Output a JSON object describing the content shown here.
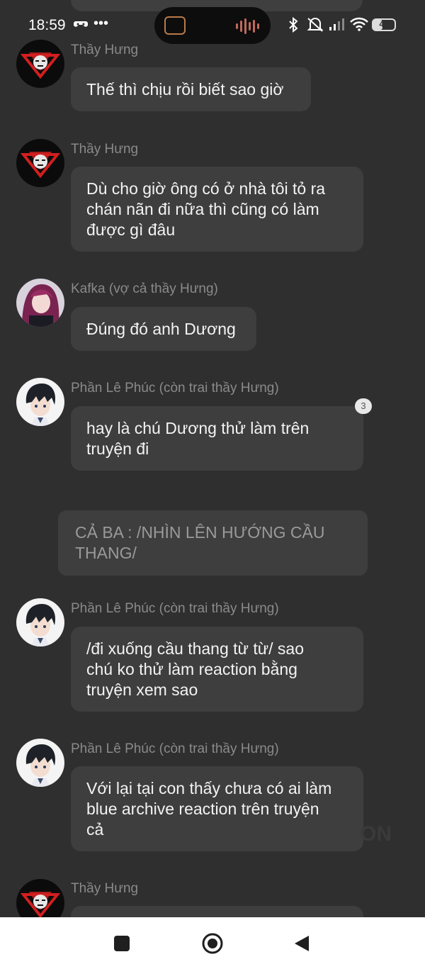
{
  "status_bar": {
    "time": "18:59",
    "battery_level": "43",
    "battery_fraction": 0.43,
    "icons": [
      "game-controller-icon",
      "more-dots-icon",
      "bluetooth-icon",
      "mute-icon",
      "signal-icon",
      "wifi-icon",
      "battery-icon"
    ]
  },
  "messages": [
    {
      "sender": "Thầy Hưng",
      "avatar": "demon-mask-avatar",
      "text": "Thế thì chịu rồi biết sao giờ"
    },
    {
      "sender": "Thầy Hưng",
      "avatar": "demon-mask-avatar",
      "text": "Dù cho giờ ông có ở nhà tôi tỏ ra\nchán nãn đi nữa thì cũng có làm\nđược gì đâu"
    },
    {
      "sender": "Kafka (vợ cả thầy Hưng)",
      "avatar": "purple-hair-avatar",
      "text": "Đúng đó anh Dương"
    },
    {
      "sender": "Phần Lê Phúc (còn trai thầy Hưng)",
      "avatar": "dark-hair-boy-avatar",
      "text": "hay là chú Dương thử làm trên\ntruyện đi",
      "badge": "3"
    },
    {
      "sender": "Phần Lê Phúc (còn trai thầy Hưng)",
      "avatar": "dark-hair-boy-avatar",
      "text": "/đi xuống cầu thang từ từ/ sao\nchú ko thử làm reaction bằng\ntruyện xem sao"
    },
    {
      "sender": "Phần Lê Phúc (còn trai thầy Hưng)",
      "avatar": "dark-hair-boy-avatar",
      "text": "Với lại tại con thấy chưa có ai làm\nblue archive reaction trên truyện\ncả"
    },
    {
      "sender": "Thầy Hưng",
      "avatar": "demon-mask-avatar",
      "text": ""
    }
  ],
  "narration": {
    "text": "CẢ BA : /NHÌN LÊN HƯỚNG CẦU\nTHANG/"
  },
  "watermark": "ON",
  "nav_bar": {
    "icons": [
      "recents-square-icon",
      "home-circle-icon",
      "back-triangle-icon"
    ]
  },
  "colors": {
    "background": "#2f2f2f",
    "bubble": "#3e3e3e",
    "name": "#8a8a8a",
    "text": "#f3f3f3"
  }
}
